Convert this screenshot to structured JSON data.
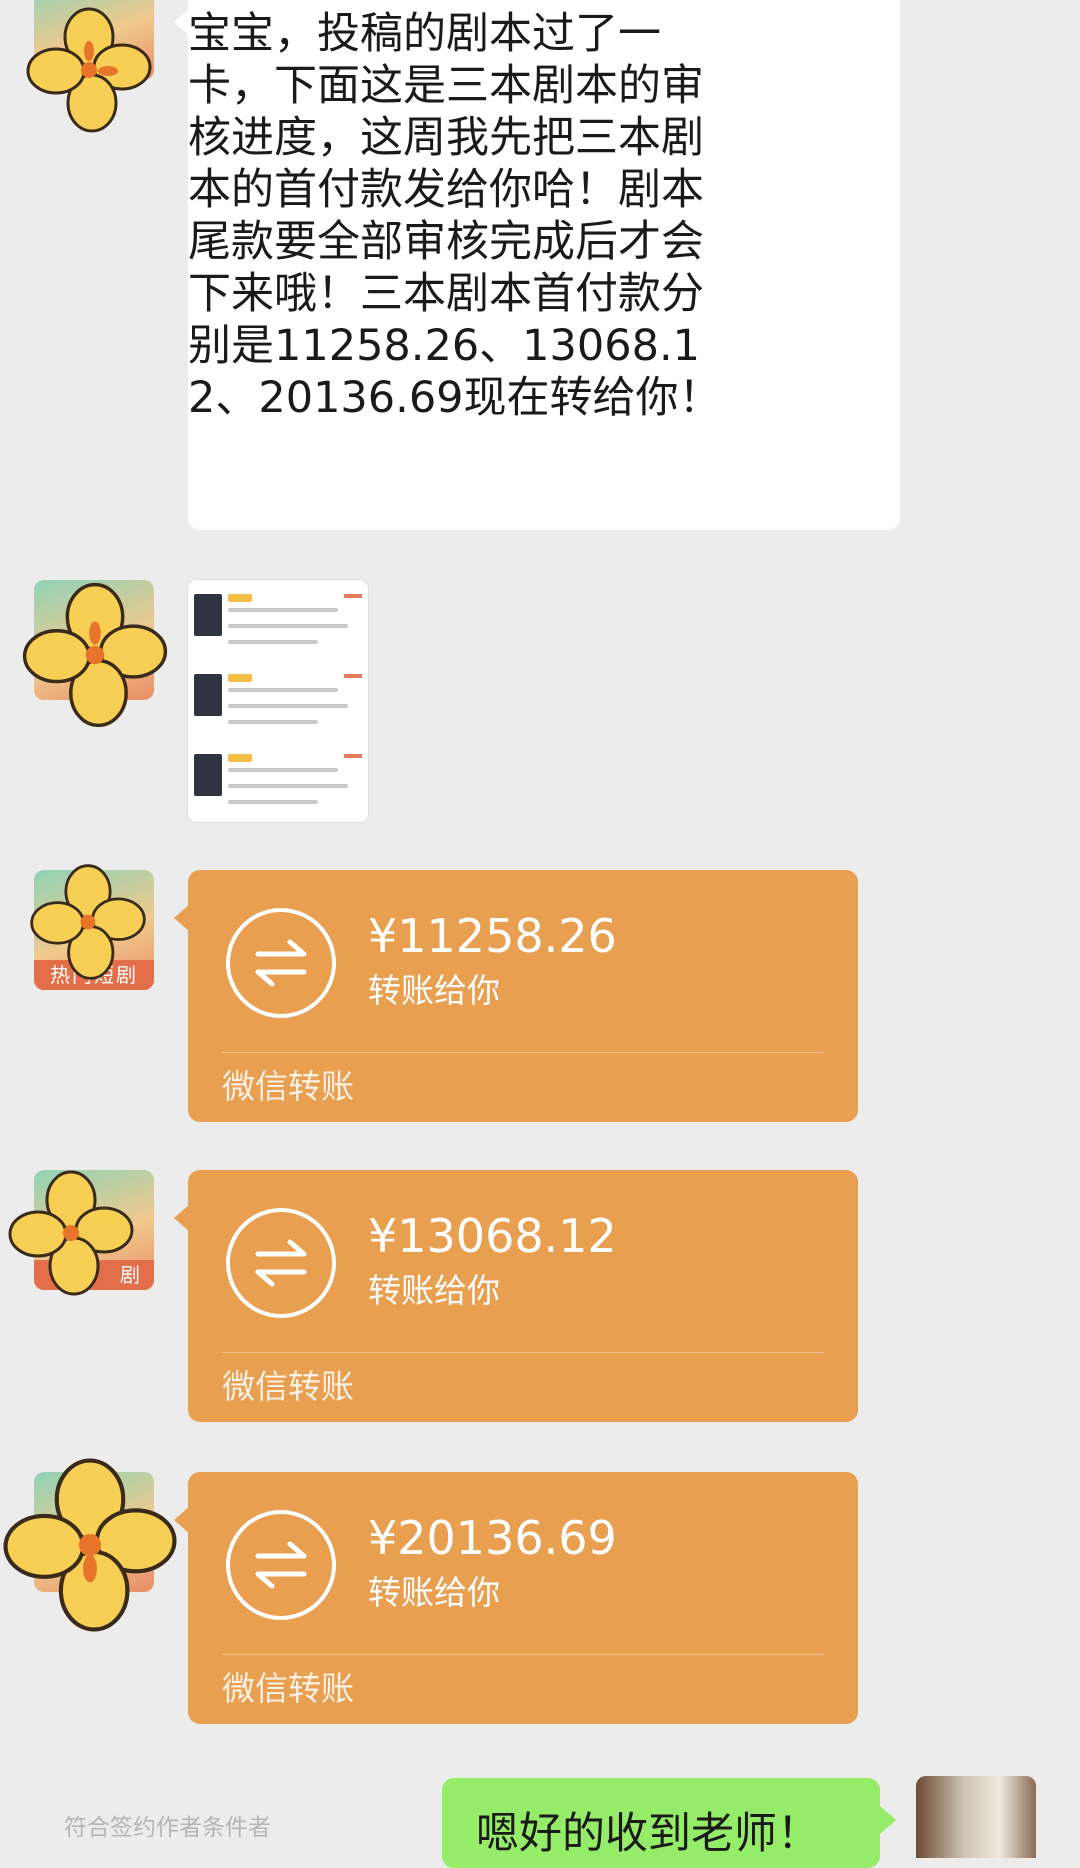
{
  "messages": {
    "text_message": "宝宝，投稿的剧本过了一卡，下面这是三本剧本的审核进度，这周我先把三本剧本的首付款发给你哈！剧本尾款要全部审核完成后才会下来哦！三本剧本首付款分别是11258.26、13068.12、20136.69现在转给你！"
  },
  "avatar": {
    "tag_text": "热门短剧",
    "tag_text_short": "剧"
  },
  "transfers": [
    {
      "amount": "¥11258.26",
      "subtitle": "转账给你",
      "footer": "微信转账"
    },
    {
      "amount": "¥13068.12",
      "subtitle": "转账给你",
      "footer": "微信转账"
    },
    {
      "amount": "¥20136.69",
      "subtitle": "转账给你",
      "footer": "微信转账"
    }
  ],
  "bottom": {
    "watermark": "符合签约作者条件者",
    "reply_text": "嗯好的收到老师！"
  },
  "colors": {
    "transfer_bg": "#e89f4f",
    "chat_bg": "#ececec",
    "reply_bg": "#95ec69"
  }
}
